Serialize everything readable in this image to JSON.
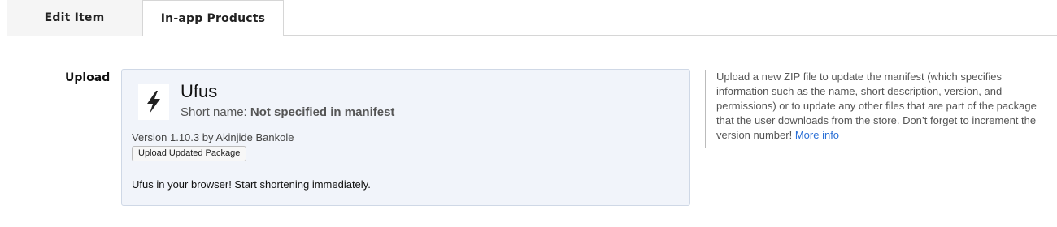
{
  "tabs": [
    {
      "label": "Edit Item",
      "active": true
    },
    {
      "label": "In-app Products",
      "active": false
    }
  ],
  "section": {
    "label": "Upload"
  },
  "item": {
    "name": "Ufus",
    "short_name_label": "Short name:",
    "short_name_value": "Not specified in manifest",
    "version_line": "Version 1.10.3 by Akinjide Bankole",
    "upload_button": "Upload Updated Package",
    "description": "Ufus in your browser! Start shortening immediately.",
    "logo_icon": "lightning-bolt-icon"
  },
  "help": {
    "text": "Upload a new ZIP file to update the manifest (which specifies information such as the name, short description, version, and permissions) or to update any other files that are part of the package that the user downloads from the store. Don’t forget to increment the version number!",
    "link_label": "More info"
  },
  "colors": {
    "card_bg": "#f1f4fa",
    "card_border": "#cfd8e6",
    "link": "#2a6fd6",
    "active_tab_bg": "#f5f5f5"
  }
}
